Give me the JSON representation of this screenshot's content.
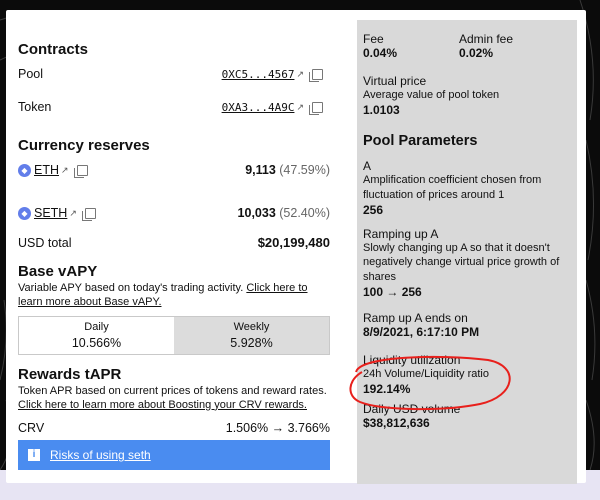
{
  "contracts": {
    "title": "Contracts",
    "pool": {
      "label": "Pool",
      "address": "0XC5...4567"
    },
    "token": {
      "label": "Token",
      "address": "0XA3...4A9C"
    }
  },
  "reserves": {
    "title": "Currency reserves",
    "eth": {
      "symbol": "ETH",
      "amount": "9,113",
      "pct": "(47.59%)"
    },
    "seth": {
      "symbol": "SETH",
      "amount": "10,033",
      "pct": "(52.40%)"
    },
    "total_label": "USD total",
    "total_value": "$20,199,480"
  },
  "vapy": {
    "title": "Base vAPY",
    "desc": "Variable APY based on today's trading activity.",
    "link": "Click here to learn more about Base vAPY.",
    "tabs": [
      {
        "label": "Daily",
        "value": "10.566%"
      },
      {
        "label": "Weekly",
        "value": "5.928%"
      }
    ]
  },
  "tapr": {
    "title": "Rewards tAPR",
    "desc": "Token APR based on current prices of tokens and reward rates.",
    "link": "Click here to learn more about Boosting your CRV rewards.",
    "crv_label": "CRV",
    "crv_value": "1.506% → 3.766%"
  },
  "risk": {
    "label": "Risks of using seth"
  },
  "right": {
    "fee_label": "Fee",
    "fee_value": "0.04%",
    "admin_fee_label": "Admin fee",
    "admin_fee_value": "0.02%",
    "vprice_label": "Virtual price",
    "vprice_desc": "Average value of pool token",
    "vprice_value": "1.0103",
    "params_title": "Pool Parameters",
    "a_label": "A",
    "a_desc": "Amplification coefficient chosen from fluctuation of prices around 1",
    "a_value": "256",
    "ramp_label": "Ramping up A",
    "ramp_desc": "Slowly changing up A so that it doesn't negatively change virtual price growth of shares",
    "ramp_value": "100 → 256",
    "ramp_end_label": "Ramp up A ends on",
    "ramp_end_value": "8/9/2021, 6:17:10 PM",
    "liq_label": "Liquidity utilization",
    "liq_desc": "24h Volume/Liquidity ratio",
    "liq_value": "192.14%",
    "vol_label": "Daily USD volume",
    "vol_value": "$38,812,636"
  },
  "colors": {
    "accent": "#4a8cf0",
    "annotation": "#e8201c",
    "panel_bg": "#d9d9d9"
  }
}
